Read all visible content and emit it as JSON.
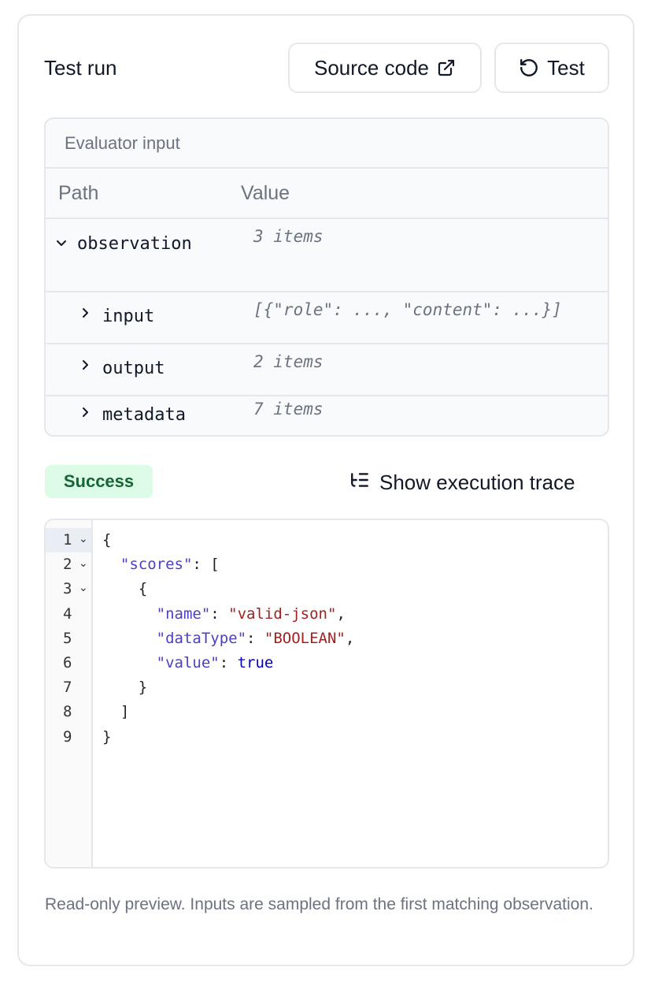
{
  "panel": {
    "title": "Test run"
  },
  "buttons": {
    "source_code": "Source code",
    "test": "Test"
  },
  "evaluator_input": {
    "caption": "Evaluator input",
    "columns": {
      "path": "Path",
      "value": "Value"
    },
    "rows": [
      {
        "key": "observation",
        "value": "3 items",
        "expanded": true
      },
      {
        "key": "input",
        "value": "[{\"role\": ..., \"content\": ...}]",
        "expanded": false
      },
      {
        "key": "output",
        "value": "2 items",
        "expanded": false
      },
      {
        "key": "metadata",
        "value": "7 items",
        "expanded": false
      }
    ]
  },
  "status": {
    "label": "Success",
    "color": "#166534",
    "background": "#dcfce7"
  },
  "trace": {
    "label": "Show execution trace"
  },
  "editor": {
    "line_numbers": [
      "1",
      "2",
      "3",
      "4",
      "5",
      "6",
      "7",
      "8",
      "9"
    ],
    "lines": [
      {
        "indent": "",
        "parts": [
          [
            "p",
            "{"
          ]
        ]
      },
      {
        "indent": "  ",
        "parts": [
          [
            "k",
            "\"scores\""
          ],
          [
            "p",
            ": ["
          ]
        ]
      },
      {
        "indent": "    ",
        "parts": [
          [
            "p",
            "{"
          ]
        ]
      },
      {
        "indent": "      ",
        "parts": [
          [
            "k",
            "\"name\""
          ],
          [
            "p",
            ": "
          ],
          [
            "s",
            "\"valid-json\""
          ],
          [
            "p",
            ","
          ]
        ]
      },
      {
        "indent": "      ",
        "parts": [
          [
            "k",
            "\"dataType\""
          ],
          [
            "p",
            ": "
          ],
          [
            "s",
            "\"BOOLEAN\""
          ],
          [
            "p",
            ","
          ]
        ]
      },
      {
        "indent": "      ",
        "parts": [
          [
            "k",
            "\"value\""
          ],
          [
            "p",
            ": "
          ],
          [
            "b",
            "true"
          ]
        ]
      },
      {
        "indent": "    ",
        "parts": [
          [
            "p",
            "}"
          ]
        ]
      },
      {
        "indent": "  ",
        "parts": [
          [
            "p",
            "]"
          ]
        ]
      },
      {
        "indent": "",
        "parts": [
          [
            "p",
            "}"
          ]
        ]
      }
    ],
    "syntax_colors": {
      "key": "#4b3fc4",
      "string": "#a32020",
      "boolean": "#0000c8"
    }
  },
  "footnote": "Read-only preview. Inputs are sampled from the first matching observation.",
  "icons": {
    "source_code": "external-link-icon",
    "test": "rotate-ccw-icon",
    "trace": "list-tree-icon",
    "row_toggle": [
      "chevron-down-icon",
      "chevron-right-icon"
    ]
  }
}
